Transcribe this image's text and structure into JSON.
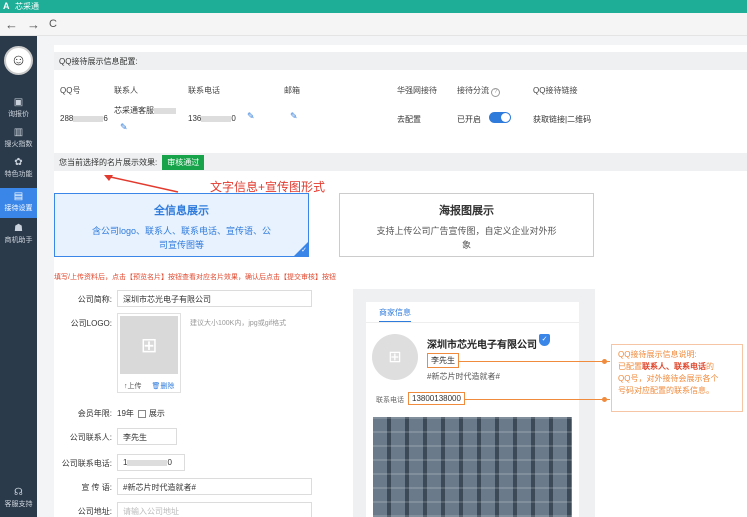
{
  "app": {
    "title": "芯采通"
  },
  "nav": {
    "back": "←",
    "forward": "→",
    "refresh": "C"
  },
  "sidebar": {
    "items": [
      {
        "label": "询报价",
        "icon": "quote-icon"
      },
      {
        "label": "搜火指数",
        "icon": "chart-icon"
      },
      {
        "label": "特色功能",
        "icon": "features-icon"
      },
      {
        "label": "接待设置",
        "icon": "reception-icon"
      },
      {
        "label": "商机助手",
        "icon": "robot-icon"
      },
      {
        "label": "客服支持",
        "icon": "support-icon"
      }
    ]
  },
  "qq_section": {
    "title": "QQ接待展示信息配置:",
    "headers": [
      "QQ号",
      "联系人",
      "联系电话",
      "邮箱",
      "华强网接待",
      "接待分流",
      "QQ接待链接"
    ],
    "row": {
      "qq": "288",
      "qq_tail": "6",
      "contact": "芯采通客服",
      "phone": "136",
      "phone_tail": "0",
      "config": "去配置",
      "status": "已开启",
      "links": "获取链接|二维码"
    },
    "help": "?"
  },
  "display_section": {
    "label": "您当前选择的名片展示效果:",
    "badge": "审核通过",
    "annotation": "文字信息+宣传图形式",
    "cards": [
      {
        "title": "全信息展示",
        "desc": "含公司logo、联系人、联系电话、宣传语、公司宣传图等"
      },
      {
        "title": "海报图展示",
        "desc": "支持上传公司广告宣传图，自定义企业对外形象"
      }
    ],
    "tip": "填写/上传资料后，点击【预览名片】按钮查看对应名片效果，确认后点击【提交审核】按钮"
  },
  "form": {
    "company_name_label": "公司简称:",
    "company_name": "深圳市芯光电子有限公司",
    "logo_label": "公司LOGO:",
    "logo_hint": "建议大小100K内，jpg或gif格式",
    "upload": "↑上传",
    "delete": "删除",
    "member_label": "会员年限:",
    "member_years": "19年",
    "member_show": "展示",
    "contact_label": "公司联系人:",
    "contact": "李先生",
    "phone_label": "公司联系电话:",
    "phone": "1",
    "phone_tail": "0",
    "slogan_label": "宣 传 语:",
    "slogan": "#新芯片时代造就者#",
    "address_label": "公司地址:",
    "address_placeholder": "请输入公司地址"
  },
  "preview": {
    "tab": "商家信息",
    "company": "深圳市芯光电子有限公司",
    "name": "李先生",
    "slogan": "#新芯片时代造就者#",
    "tel_label": "联系电话",
    "tel": "13800138000"
  },
  "note": {
    "line1": "QQ接待展示信息说明:",
    "line2a": "已配置",
    "line2b": "联系人、联系电话",
    "line2c": "的",
    "line3": "QQ号，对外接待会展示各个",
    "line4": "号码对应配置的联系信息。"
  },
  "colors": {
    "accent": "#2f7bdc",
    "brand": "#1eae98",
    "warning": "#f08a3c",
    "success": "#17a34a"
  }
}
